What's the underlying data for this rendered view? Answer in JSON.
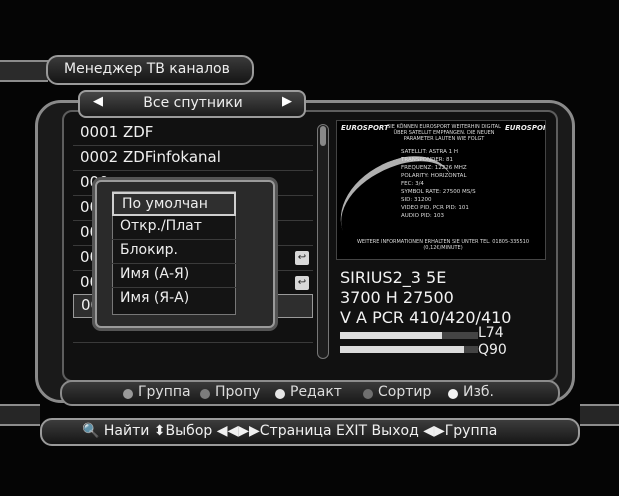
{
  "colors": {
    "background": "#050505",
    "frame": "#8a8a8a",
    "text": "#eeeeee",
    "meter_fill": "#dcdcdc"
  },
  "header": {
    "title": "Менеджер ТВ каналов"
  },
  "satellite_selector": {
    "label": "Все спутники",
    "left_arrow_icon": "arrow-left-icon",
    "right_arrow_icon": "arrow-right-icon",
    "left_glyph": "◀",
    "right_glyph": "▶"
  },
  "channels": [
    {
      "text": "0001 ZDF",
      "icon": ""
    },
    {
      "text": "0002 ZDFinfokanal",
      "icon": ""
    },
    {
      "text": "000",
      "icon": ""
    },
    {
      "text": "000",
      "icon": ""
    },
    {
      "text": "000",
      "icon": ""
    },
    {
      "text": "000",
      "icon": "↩"
    },
    {
      "text": "000",
      "icon": "↩"
    },
    {
      "text": "000",
      "icon": ""
    }
  ],
  "sort_menu": {
    "items": [
      "По умолчан",
      "Откр./Плат",
      "Блокир.",
      "Имя (А-Я)",
      "Имя (Я-А)"
    ],
    "selected_index": 0
  },
  "banner": {
    "logo_left": "EUROSPORT",
    "logo_right": "EUROSPORT",
    "top_text": "SIE KÖNNEN EUROSPORT WEITERHIN DIGITAL ÜBER SATELLIT EMPFANGEN. DIE NEUEN PARAMETER LAUTEN WIE FOLGT",
    "lines": [
      "SATELLIT: ASTRA 1 H",
      "TRANSPONDER: 81",
      "FREQUENZ: 12226 MHZ",
      "POLARITY: HORIZONTAL",
      "FEC: 3/4",
      "SYMBOL RATE: 27500 MS/S",
      "SID: 31200",
      "VIDEO PID, PCR PID: 101",
      "AUDIO PID: 103"
    ],
    "bottom_text": "WEITERE INFORMATIONEN ERHALTEN SIE UNTER TEL. 01805-335510 (0,12€/MINUTE)"
  },
  "info": {
    "satellite": "SIRIUS2_3 5E",
    "tp": "3700 H 27500",
    "pids": "V A PCR 410/420/410",
    "level_label": "L74",
    "quality_label": "Q90",
    "level": 74,
    "quality": 90
  },
  "color_buttons": [
    {
      "label": "Группа",
      "color": "#9a9a9a"
    },
    {
      "label": "Пропу",
      "color": "#7d7d7d"
    },
    {
      "label": "Редакт",
      "color": "#e6e6e6"
    },
    {
      "label": "Сортир",
      "color": "#6f6f6f"
    },
    {
      "label": "Изб.",
      "color": "#f2f2f2"
    }
  ],
  "hint_bar": {
    "text": "🔍 Найти ⬍Выбор ◀◀▶▶Страница EXIT Выход ◀▶Группа"
  }
}
